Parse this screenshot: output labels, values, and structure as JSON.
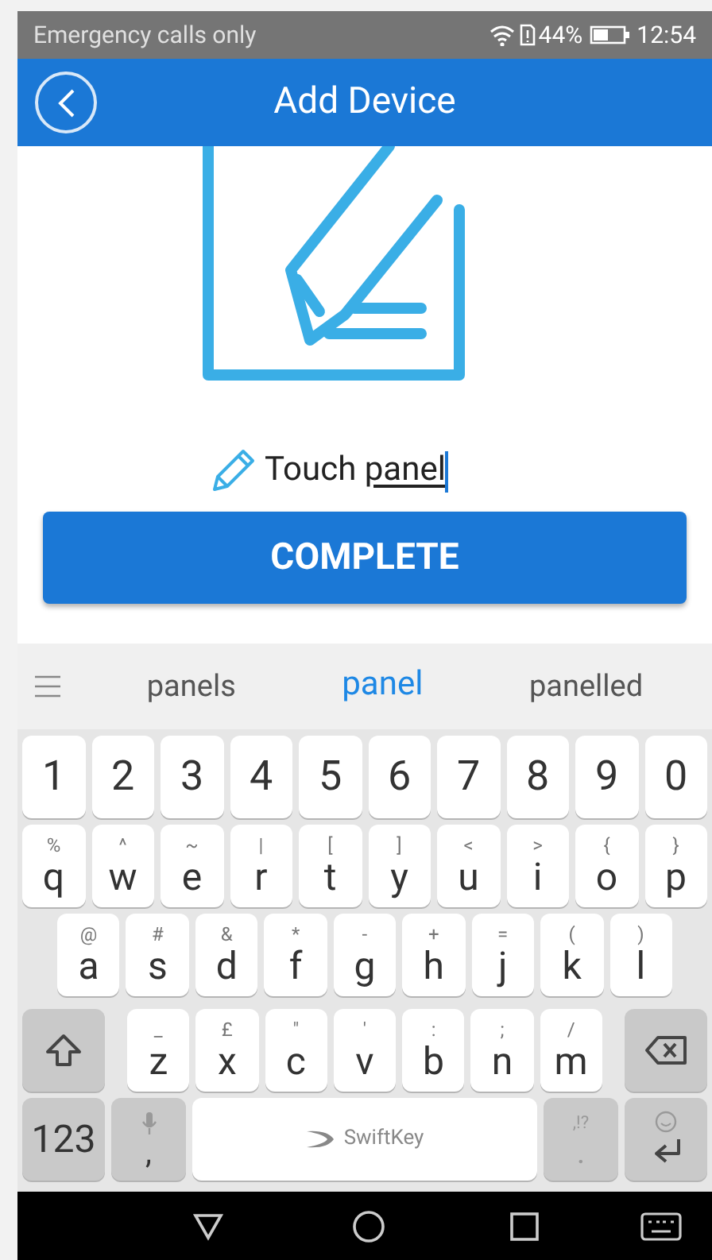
{
  "status_bar": {
    "carrier": "Emergency calls only",
    "battery": "44%",
    "time": "12:54"
  },
  "header": {
    "title": "Add Device"
  },
  "name_field": {
    "text": "Touch",
    "composing": "panel"
  },
  "complete_button": {
    "label": "COMPLETE"
  },
  "keyboard": {
    "suggestions": [
      {
        "label": "panels",
        "selected": false
      },
      {
        "label": "panel",
        "selected": true
      },
      {
        "label": "panelled",
        "selected": false
      }
    ],
    "rows": [
      [
        {
          "kind": "char",
          "label": "1"
        },
        {
          "kind": "char",
          "label": "2"
        },
        {
          "kind": "char",
          "label": "3"
        },
        {
          "kind": "char",
          "label": "4"
        },
        {
          "kind": "char",
          "label": "5"
        },
        {
          "kind": "char",
          "label": "6"
        },
        {
          "kind": "char",
          "label": "7"
        },
        {
          "kind": "char",
          "label": "8"
        },
        {
          "kind": "char",
          "label": "9"
        },
        {
          "kind": "char",
          "label": "0"
        }
      ],
      [
        {
          "kind": "char",
          "label": "q",
          "secondary": "%"
        },
        {
          "kind": "char",
          "label": "w",
          "secondary": "^"
        },
        {
          "kind": "char",
          "label": "e",
          "secondary": "~"
        },
        {
          "kind": "char",
          "label": "r",
          "secondary": "|"
        },
        {
          "kind": "char",
          "label": "t",
          "secondary": "["
        },
        {
          "kind": "char",
          "label": "y",
          "secondary": "]"
        },
        {
          "kind": "char",
          "label": "u",
          "secondary": "<"
        },
        {
          "kind": "char",
          "label": "i",
          "secondary": ">"
        },
        {
          "kind": "char",
          "label": "o",
          "secondary": "{"
        },
        {
          "kind": "char",
          "label": "p",
          "secondary": "}"
        }
      ],
      [
        {
          "kind": "char",
          "label": "a",
          "secondary": "@"
        },
        {
          "kind": "char",
          "label": "s",
          "secondary": "#"
        },
        {
          "kind": "char",
          "label": "d",
          "secondary": "&"
        },
        {
          "kind": "char",
          "label": "f",
          "secondary": "*"
        },
        {
          "kind": "char",
          "label": "g",
          "secondary": "-"
        },
        {
          "kind": "char",
          "label": "h",
          "secondary": "+"
        },
        {
          "kind": "char",
          "label": "j",
          "secondary": "="
        },
        {
          "kind": "char",
          "label": "k",
          "secondary": "("
        },
        {
          "kind": "char",
          "label": "l",
          "secondary": ")"
        }
      ],
      [
        {
          "kind": "shift"
        },
        {
          "kind": "char",
          "label": "z",
          "secondary": "_"
        },
        {
          "kind": "char",
          "label": "x",
          "secondary": "£"
        },
        {
          "kind": "char",
          "label": "c",
          "secondary": "\""
        },
        {
          "kind": "char",
          "label": "v",
          "secondary": "'"
        },
        {
          "kind": "char",
          "label": "b",
          "secondary": ":"
        },
        {
          "kind": "char",
          "label": "n",
          "secondary": ";"
        },
        {
          "kind": "char",
          "label": "m",
          "secondary": "/"
        },
        {
          "kind": "backspace"
        }
      ],
      [
        {
          "kind": "symbols",
          "label": "123"
        },
        {
          "kind": "mic",
          "label": ","
        },
        {
          "kind": "space",
          "label": "SwiftKey"
        },
        {
          "kind": "punct",
          "label": ".",
          "secondary": ",!?"
        },
        {
          "kind": "enter"
        }
      ]
    ]
  }
}
